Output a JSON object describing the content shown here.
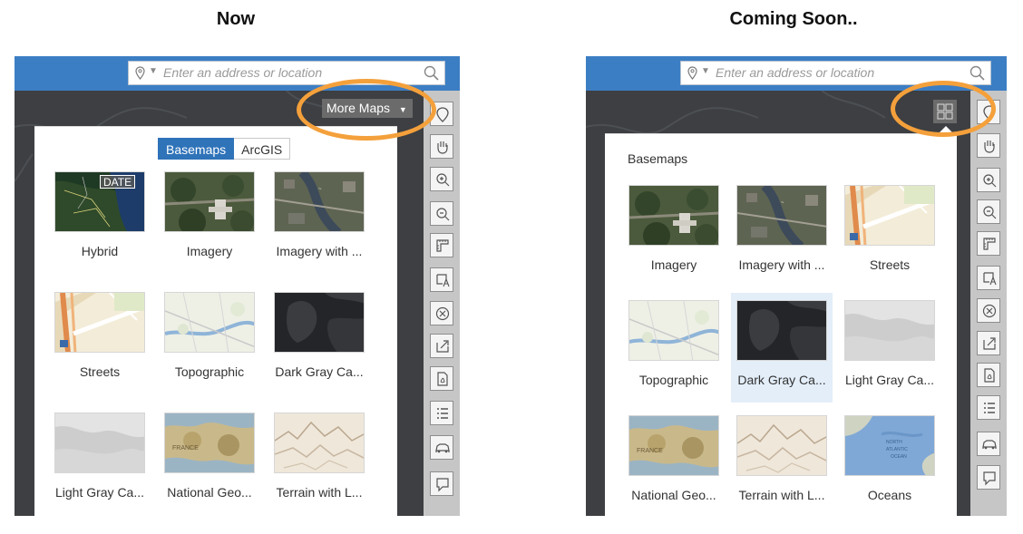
{
  "headings": {
    "now": "Now",
    "coming_soon": "Coming Soon.."
  },
  "search": {
    "placeholder": "Enter an address or location"
  },
  "now_panel": {
    "more_maps_label": "More Maps",
    "tabs": [
      {
        "label": "Basemaps",
        "active": true
      },
      {
        "label": "ArcGIS",
        "active": false
      }
    ],
    "date_badge": "DATE",
    "items": [
      {
        "label": "Hybrid",
        "thumb": "hybrid"
      },
      {
        "label": "Imagery",
        "thumb": "imagery"
      },
      {
        "label": "Imagery with ...",
        "thumb": "imagery-labels"
      },
      {
        "label": "Streets",
        "thumb": "streets"
      },
      {
        "label": "Topographic",
        "thumb": "topo"
      },
      {
        "label": "Dark Gray Ca...",
        "thumb": "darkgray"
      },
      {
        "label": "Light Gray Ca...",
        "thumb": "lightgray"
      },
      {
        "label": "National Geo...",
        "thumb": "natgeo"
      },
      {
        "label": "Terrain with L...",
        "thumb": "terrain"
      }
    ]
  },
  "soon_panel": {
    "section_title": "Basemaps",
    "selected_index": 4,
    "items": [
      {
        "label": "Imagery",
        "thumb": "imagery"
      },
      {
        "label": "Imagery with ...",
        "thumb": "imagery-labels"
      },
      {
        "label": "Streets",
        "thumb": "streets"
      },
      {
        "label": "Topographic",
        "thumb": "topo"
      },
      {
        "label": "Dark Gray Ca...",
        "thumb": "darkgray"
      },
      {
        "label": "Light Gray Ca...",
        "thumb": "lightgray"
      },
      {
        "label": "National Geo...",
        "thumb": "natgeo"
      },
      {
        "label": "Terrain with L...",
        "thumb": "terrain"
      },
      {
        "label": "Oceans",
        "thumb": "oceans"
      }
    ]
  },
  "toolbar_icons": [
    "locate-icon",
    "pan-hand-icon",
    "zoom-in-icon",
    "zoom-out-icon",
    "measure-icon",
    "text-note-icon",
    "clear-icon",
    "share-icon",
    "print-pdf-icon",
    "legend-list-icon",
    "directions-car-icon",
    "comment-icon"
  ],
  "colors": {
    "header_blue": "#3c7ec4",
    "highlight_orange": "#f4a03b",
    "tab_active": "#2f73b9",
    "selected_bg": "#e3eef9"
  }
}
